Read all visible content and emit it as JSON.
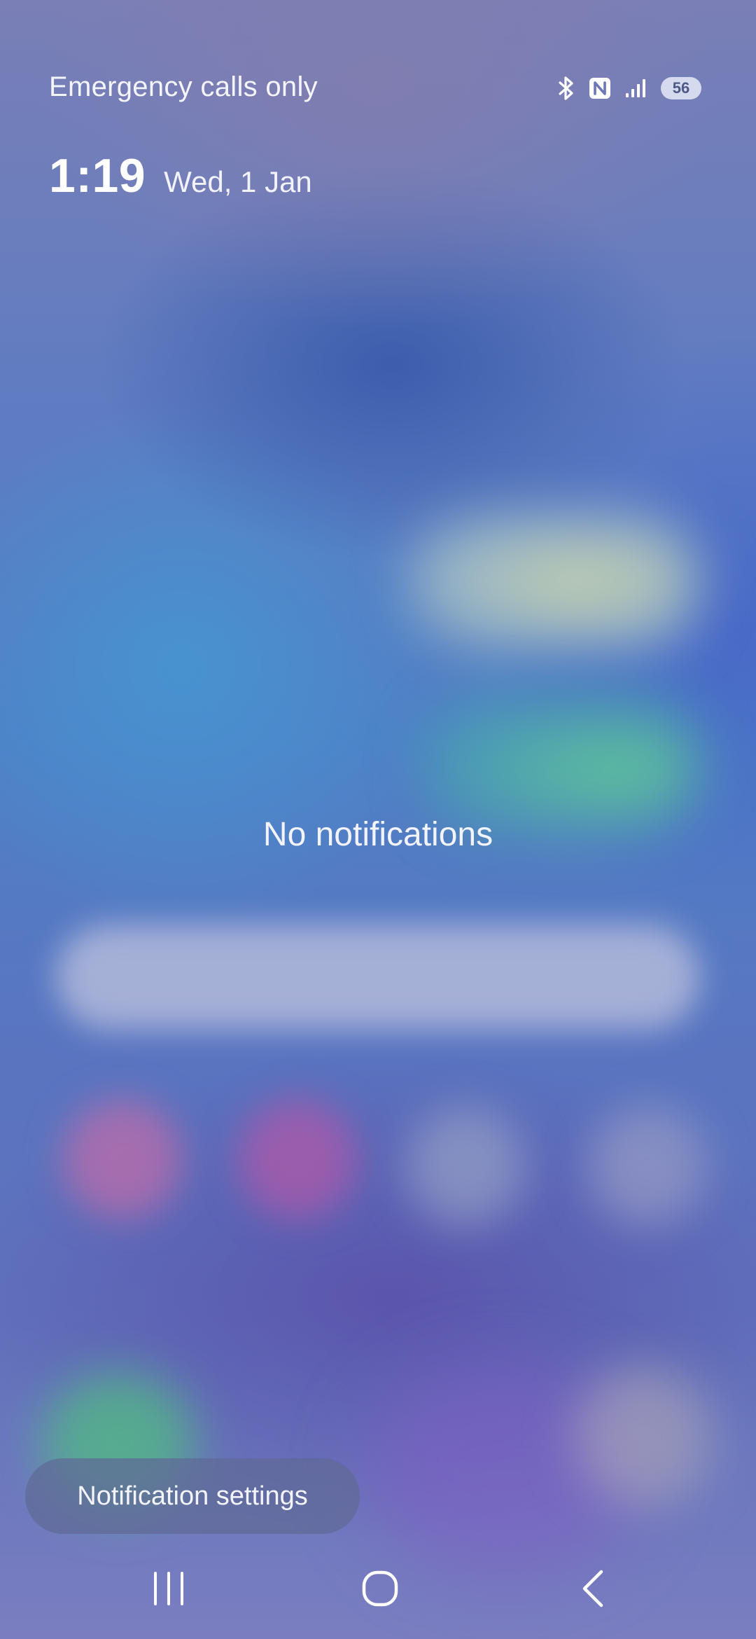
{
  "status_bar": {
    "carrier": "Emergency calls only",
    "icons": [
      "bluetooth-icon",
      "nfc-icon",
      "signal-icon"
    ],
    "battery_level": "56"
  },
  "clock": {
    "time": "1:19",
    "date": "Wed, 1 Jan"
  },
  "notifications": {
    "empty_message": "No notifications",
    "settings_button": "Notification settings"
  },
  "navigation": {
    "buttons": [
      "recents-icon",
      "home-icon",
      "back-icon"
    ]
  },
  "colors": {
    "text": "#ffffff",
    "battery_text": "#4d5a86",
    "pill_background": "#5f6996"
  }
}
